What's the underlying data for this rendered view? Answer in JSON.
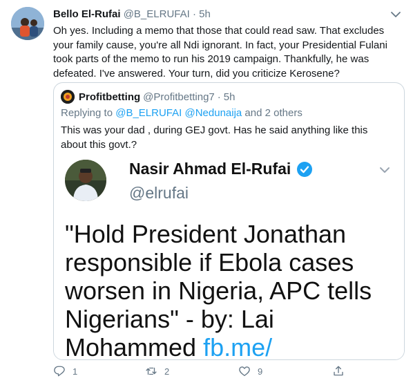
{
  "tweet": {
    "author_name": "Bello El-Rufai",
    "author_handle": "@B_ELRUFAI",
    "separator": "·",
    "time": "5h",
    "text": "Oh yes. Including a memo that those that could read saw. That excludes your family cause, you're all Ndi ignorant. In fact, your Presidential Fulani took parts of the memo to run his 2019 campaign. Thankfully, he was defeated. I've answered. Your turn, did you criticize Kerosene?"
  },
  "quoted": {
    "author_name": "Profitbetting",
    "author_handle": "@Profitbetting7",
    "separator": "·",
    "time": "5h",
    "replying_prefix": "Replying to ",
    "replying_to": "@B_ELRUFAI @Nedunaija",
    "replying_suffix": " and 2 others",
    "text": "This was your dad , during GEJ govt.  Has he said anything like this about this govt.?",
    "image": {
      "name": "Nasir Ahmad El-Rufai",
      "handle": "@elrufai",
      "text": "\"Hold President Jonathan responsible if Ebola cases worsen in Nigeria, APC tells Nigerians\" - by: Lai Mohammed",
      "link_fragment": "fb.me/"
    }
  },
  "actions": {
    "reply_count": "1",
    "retweet_count": "2",
    "like_count": "9",
    "icons": [
      "reply-icon",
      "retweet-icon",
      "like-icon",
      "share-icon"
    ]
  },
  "colors": {
    "link": "#1da1f2",
    "muted": "#657786",
    "border": "#ccd6dd"
  }
}
